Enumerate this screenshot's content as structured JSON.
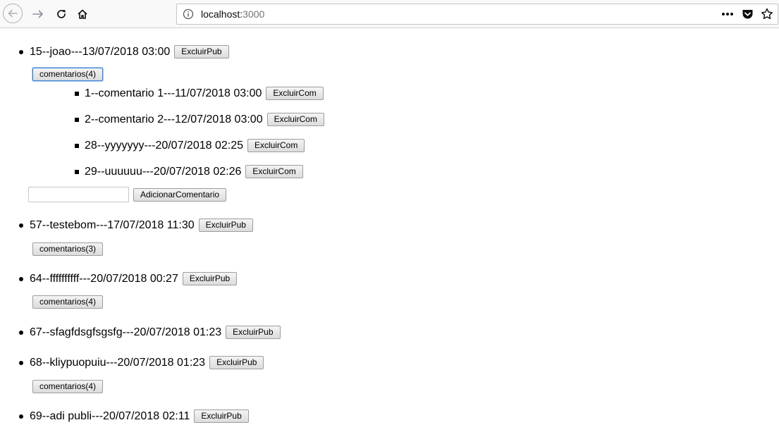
{
  "browser": {
    "url_host": "localhost:",
    "url_port": "3000"
  },
  "posts": [
    {
      "text": "15--joao---13/07/2018 03:00",
      "delete_label": "ExcluirPub",
      "comments_label": "comentarios(4)"
    },
    {
      "text": "57--testebom---17/07/2018 11:30",
      "delete_label": "ExcluirPub",
      "comments_label": "comentarios(3)"
    },
    {
      "text": "64--ffffffffff---20/07/2018 00:27",
      "delete_label": "ExcluirPub",
      "comments_label": "comentarios(4)"
    },
    {
      "text": "67--sfagfdsgfsgsfg---20/07/2018 01:23",
      "delete_label": "ExcluirPub"
    },
    {
      "text": "68--kliypuopuiu---20/07/2018 01:23",
      "delete_label": "ExcluirPub",
      "comments_label": "comentarios(4)"
    },
    {
      "text": "69--adi publi---20/07/2018 02:11",
      "delete_label": "ExcluirPub"
    }
  ],
  "comments": [
    {
      "text": "1--comentario 1---11/07/2018 03:00",
      "delete_label": "ExcluirCom"
    },
    {
      "text": "2--comentario 2---12/07/2018 03:00",
      "delete_label": "ExcluirCom"
    },
    {
      "text": "28--yyyyyyy---20/07/2018 02:25",
      "delete_label": "ExcluirCom"
    },
    {
      "text": "29--uuuuuu---20/07/2018 02:26",
      "delete_label": "ExcluirCom"
    }
  ],
  "add_comment": {
    "input_value": "",
    "button_label": "AdicionarComentario"
  }
}
